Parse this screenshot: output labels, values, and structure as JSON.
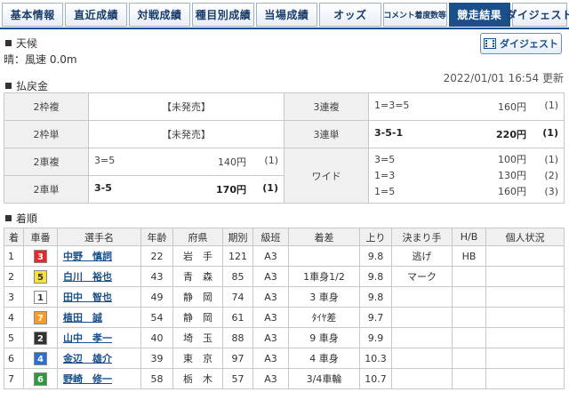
{
  "tabs": [
    {
      "label": "基本情報",
      "active": false,
      "small": false,
      "w": 72
    },
    {
      "label": "直近成績",
      "active": false,
      "small": false,
      "w": 72
    },
    {
      "label": "対戦成績",
      "active": false,
      "small": false,
      "w": 72
    },
    {
      "label": "種目別成績",
      "active": false,
      "small": false,
      "w": 72
    },
    {
      "label": "当場成績",
      "active": false,
      "small": false,
      "w": 72
    },
    {
      "label": "オッズ",
      "active": false,
      "small": false,
      "w": 72
    },
    {
      "label": "コメント着度数等",
      "active": false,
      "small": true,
      "w": 72
    },
    {
      "label": "競走結果",
      "active": true,
      "small": false,
      "w": 72
    },
    {
      "label": "ダイジェスト",
      "active": false,
      "small": false,
      "w": 62
    }
  ],
  "weather": {
    "heading": "天候",
    "text": "晴：風速 0.0m"
  },
  "digest_button": "ダイジェスト",
  "updated": "2022/01/01 16:54 更新",
  "payout": {
    "heading": "払戻金",
    "waku_fuku": {
      "label": "2枠複",
      "value": "【未発売】"
    },
    "waku_tan": {
      "label": "2枠単",
      "value": "【未発売】"
    },
    "rentan3_fuku": {
      "label": "3連複",
      "combo": "1=3=5",
      "amount": "160円",
      "pop": "(1)"
    },
    "rentan3_tan": {
      "label": "3連単",
      "combo": "3-5-1",
      "amount": "220円",
      "pop": "(1)"
    },
    "sha_fuku": {
      "label": "2車複",
      "combo": "3=5",
      "amount": "140円",
      "pop": "(1)"
    },
    "sha_tan": {
      "label": "2車単",
      "combo": "3-5",
      "amount": "170円",
      "pop": "(1)"
    },
    "wide": {
      "label": "ワイド",
      "rows": [
        {
          "combo": "3=5",
          "amount": "100円",
          "pop": "(1)"
        },
        {
          "combo": "1=3",
          "amount": "130円",
          "pop": "(2)"
        },
        {
          "combo": "1=5",
          "amount": "160円",
          "pop": "(3)"
        }
      ]
    }
  },
  "results": {
    "heading": "着順",
    "columns": [
      "着",
      "車番",
      "選手名",
      "年齢",
      "府県",
      "期別",
      "級班",
      "着差",
      "上り",
      "決まり手",
      "H/B",
      "個人状況"
    ],
    "rows": [
      {
        "rank": "1",
        "car": "3",
        "badge_bg": "#e8262b",
        "badge_fg": "#ffffff",
        "name": "中野　慎詞",
        "age": "22",
        "pref": "岩　手",
        "term": "121",
        "class": "A3",
        "diff": "",
        "up": "9.8",
        "kimarite": "逃げ",
        "hb": "HB",
        "status": ""
      },
      {
        "rank": "2",
        "car": "5",
        "badge_bg": "#f5e13a",
        "badge_fg": "#333333",
        "name": "白川　裕也",
        "age": "43",
        "pref": "青　森",
        "term": "85",
        "class": "A3",
        "diff": "1車身1/2",
        "up": "9.8",
        "kimarite": "マーク",
        "hb": "",
        "status": ""
      },
      {
        "rank": "3",
        "car": "1",
        "badge_bg": "#ffffff",
        "badge_fg": "#333333",
        "name": "田中　智也",
        "age": "49",
        "pref": "静　岡",
        "term": "74",
        "class": "A3",
        "diff": "3 車身",
        "up": "9.8",
        "kimarite": "",
        "hb": "",
        "status": ""
      },
      {
        "rank": "4",
        "car": "7",
        "badge_bg": "#f39c2b",
        "badge_fg": "#ffffff",
        "name": "植田　誠",
        "age": "54",
        "pref": "静　岡",
        "term": "61",
        "class": "A3",
        "diff": "ﾀｲﾔ差",
        "up": "9.7",
        "kimarite": "",
        "hb": "",
        "status": ""
      },
      {
        "rank": "5",
        "car": "2",
        "badge_bg": "#333333",
        "badge_fg": "#ffffff",
        "name": "山中　孝一",
        "age": "40",
        "pref": "埼　玉",
        "term": "88",
        "class": "A3",
        "diff": "9 車身",
        "up": "9.9",
        "kimarite": "",
        "hb": "",
        "status": ""
      },
      {
        "rank": "6",
        "car": "4",
        "badge_bg": "#2a6fd6",
        "badge_fg": "#ffffff",
        "name": "金辺　雄介",
        "age": "39",
        "pref": "東　京",
        "term": "97",
        "class": "A3",
        "diff": "4 車身",
        "up": "10.3",
        "kimarite": "",
        "hb": "",
        "status": ""
      },
      {
        "rank": "7",
        "car": "6",
        "badge_bg": "#2e9a3e",
        "badge_fg": "#ffffff",
        "name": "野崎　修一",
        "age": "58",
        "pref": "栃　木",
        "term": "57",
        "class": "A3",
        "diff": "3/4車輪",
        "up": "10.7",
        "kimarite": "",
        "hb": "",
        "status": ""
      }
    ]
  }
}
